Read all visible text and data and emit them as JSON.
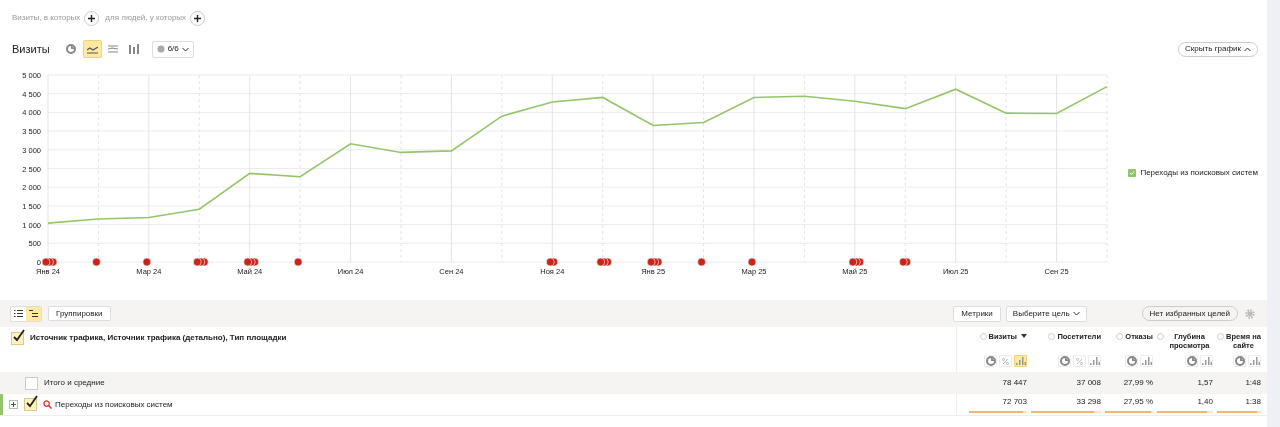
{
  "segment_filter": {
    "visits_label": "Визиты, в которых",
    "people_label": "для людей, у которых"
  },
  "chart_header": {
    "title": "Визиты",
    "chart_types": [
      {
        "kind": "pie",
        "selected": false
      },
      {
        "kind": "line",
        "selected": true
      },
      {
        "kind": "stacked",
        "selected": false
      },
      {
        "kind": "columns",
        "selected": false
      }
    ],
    "series_picker": "6/6",
    "hide_button": "Скрыть график"
  },
  "chart_data": {
    "type": "line",
    "categories": [
      "Янв 24",
      null,
      "Мар 24",
      null,
      "Май 24",
      null,
      "Июл 24",
      null,
      "Сен 24",
      null,
      "Ноя 24",
      null,
      "Янв 25",
      null,
      "Мар 25",
      null,
      "Май 25",
      null,
      "Июл 25",
      null,
      "Сен 25",
      null
    ],
    "yticks": [
      {
        "value": 0,
        "label": "0"
      },
      {
        "value": 500,
        "label": "500"
      },
      {
        "value": 1000,
        "label": "1 000"
      },
      {
        "value": 1500,
        "label": "1 500"
      },
      {
        "value": 2000,
        "label": "2 000"
      },
      {
        "value": 2500,
        "label": "2 500"
      },
      {
        "value": 3000,
        "label": "3 000"
      },
      {
        "value": 3500,
        "label": "3 500"
      },
      {
        "value": 4000,
        "label": "4 000"
      },
      {
        "value": 4500,
        "label": "4 500"
      },
      {
        "value": 5000,
        "label": "5 000"
      }
    ],
    "ylim": [
      0,
      5000
    ],
    "grid": true,
    "series": [
      {
        "name": "Переходы из поисковых систем",
        "color": "#95c46a",
        "values": [
          1040,
          1150,
          1190,
          1410,
          2370,
          2280,
          3160,
          2930,
          2970,
          3900,
          4280,
          4400,
          3650,
          3730,
          4400,
          4430,
          4300,
          4100,
          4620,
          3980,
          3970,
          4690
        ]
      }
    ]
  },
  "event_markers": [
    {
      "kind": "triple"
    },
    {
      "kind": "single"
    },
    {
      "kind": "single"
    },
    {
      "kind": "triple"
    },
    {
      "kind": "triple"
    },
    {
      "kind": "single"
    },
    {
      "kind": "none"
    },
    {
      "kind": "none"
    },
    {
      "kind": "none"
    },
    {
      "kind": "none"
    },
    {
      "kind": "double"
    },
    {
      "kind": "triple"
    },
    {
      "kind": "triple"
    },
    {
      "kind": "single"
    },
    {
      "kind": "single"
    },
    {
      "kind": "none"
    },
    {
      "kind": "triple"
    },
    {
      "kind": "double"
    },
    {
      "kind": "none"
    },
    {
      "kind": "none"
    },
    {
      "kind": "none"
    },
    {
      "kind": "none"
    }
  ],
  "legend": [
    {
      "checked": true
    }
  ],
  "table_toolbar": {
    "views": [
      {
        "kind": "list",
        "selected": false
      },
      {
        "kind": "tree",
        "selected": true
      }
    ],
    "groupings_button": "Группировки",
    "metrics_button": "Метрики",
    "goal_select": "Выберите цель",
    "favorite_goals_button": "Нет избранных целей"
  },
  "table": {
    "grouping_header": {
      "label": "Источник трафика, Источник трафика (детально), Тип площадки",
      "checked": true
    },
    "columns": [
      {
        "label": "Визиты",
        "sorted": true,
        "views": [
          {
            "kind": "pie",
            "selected": false
          },
          {
            "kind": "percent",
            "selected": false
          },
          {
            "kind": "bars",
            "selected": true
          }
        ]
      },
      {
        "label": "Посетители",
        "sorted": false,
        "views": [
          {
            "kind": "pie",
            "selected": false
          },
          {
            "kind": "percent",
            "selected": false
          },
          {
            "kind": "bars",
            "selected": false
          }
        ]
      },
      {
        "label": "Отказы",
        "sorted": false,
        "views": [
          {
            "kind": "pie",
            "selected": false
          },
          {
            "kind": "bars",
            "selected": false
          }
        ]
      },
      {
        "label": "Глубина просмотра",
        "sorted": false,
        "views": [
          {
            "kind": "pie",
            "selected": false
          },
          {
            "kind": "bars",
            "selected": false
          }
        ]
      },
      {
        "label": "Время на сайте",
        "sorted": false,
        "views": [
          {
            "kind": "pie",
            "selected": false
          },
          {
            "kind": "bars",
            "selected": false
          }
        ]
      }
    ],
    "totals": {
      "label": "Итого и средние",
      "checked": false,
      "values": [
        "78 447",
        "37 008",
        "27,99 %",
        "1,57",
        "1:48"
      ]
    },
    "rows": [
      {
        "label": "Переходы из поисковых систем",
        "checked": true,
        "expanded": false,
        "color": "#95c46a",
        "cells": [
          {
            "value": "72 703",
            "level": 0.93
          },
          {
            "value": "33 298",
            "level": 0.9
          },
          {
            "value": "27,95 %",
            "level": 0.95
          },
          {
            "value": "1,40",
            "level": 0.9
          },
          {
            "value": "1:38",
            "level": 0.9
          }
        ]
      }
    ]
  }
}
